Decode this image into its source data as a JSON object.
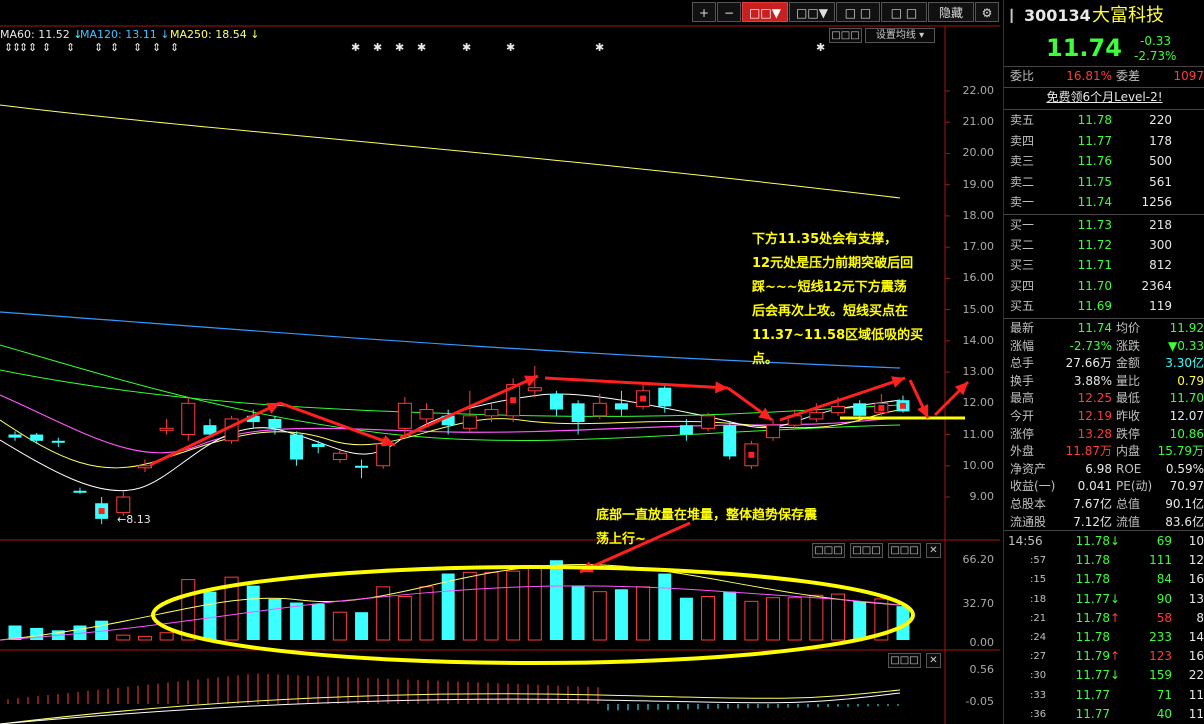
{
  "toolbar": {
    "plus": "+",
    "minus": "−",
    "btn3": "□□▼",
    "btn4": "□□▼",
    "btn5": "□ □",
    "btn6": "□ □",
    "hide": "隐藏",
    "settings_icon": "gear-icon"
  },
  "ma": {
    "ma60": "MA60: 11.52",
    "ma120": "MA120: 13.11",
    "ma250": "MA250: 18.54"
  },
  "chart_buttons": {
    "set_ma": "设置均线 ▾",
    "small": "□□□"
  },
  "price_axis": [
    "22.00",
    "21.00",
    "20.00",
    "19.00",
    "18.00",
    "17.00",
    "16.00",
    "15.00",
    "14.00",
    "13.00",
    "12.00",
    "11.00",
    "10.00",
    "9.00"
  ],
  "low_label": "8.13",
  "volume_axis": [
    "66.20",
    "32.70",
    "0.00"
  ],
  "macd_axis": [
    "0.56",
    "-0.05"
  ],
  "annotations": {
    "support": [
      "下方11.35处会有支撑，",
      "12元处是压力前期突破后回",
      "踩~~~短线12元下方震荡",
      "后会再次上攻。短线买点在",
      "11.37~11.58区域低吸的买",
      "点。"
    ],
    "volume_note": [
      "底部一直放量在堆量，整体趋势保存震",
      "荡上行~"
    ]
  },
  "chart_data": {
    "type": "candlestick",
    "ylim": [
      8,
      22.5
    ],
    "candles": [
      {
        "o": 11.0,
        "c": 10.9,
        "h": 11.1,
        "l": 10.8,
        "up": false
      },
      {
        "o": 11.0,
        "c": 10.8,
        "h": 11.05,
        "l": 10.7,
        "up": false
      },
      {
        "o": 10.8,
        "c": 10.75,
        "h": 10.9,
        "l": 10.6,
        "up": false
      },
      {
        "o": 9.2,
        "c": 9.2,
        "h": 9.3,
        "l": 9.1,
        "up": false
      },
      {
        "o": 8.8,
        "c": 8.3,
        "h": 9.0,
        "l": 8.13,
        "up": false
      },
      {
        "o": 8.5,
        "c": 9.0,
        "h": 9.2,
        "l": 8.4,
        "up": true
      },
      {
        "o": 10.0,
        "c": 10.0,
        "h": 10.2,
        "l": 9.8,
        "up": true
      },
      {
        "o": 11.2,
        "c": 11.2,
        "h": 11.5,
        "l": 11.0,
        "up": true
      },
      {
        "o": 11.0,
        "c": 12.0,
        "h": 12.2,
        "l": 10.8,
        "up": true
      },
      {
        "o": 11.3,
        "c": 11.0,
        "h": 11.5,
        "l": 10.9,
        "up": false
      },
      {
        "o": 10.8,
        "c": 11.5,
        "h": 11.6,
        "l": 10.7,
        "up": true
      },
      {
        "o": 11.6,
        "c": 11.4,
        "h": 11.8,
        "l": 11.2,
        "up": false
      },
      {
        "o": 11.5,
        "c": 11.2,
        "h": 11.6,
        "l": 11.0,
        "up": false
      },
      {
        "o": 11.0,
        "c": 10.2,
        "h": 11.1,
        "l": 10.0,
        "up": false
      },
      {
        "o": 10.7,
        "c": 10.6,
        "h": 10.8,
        "l": 10.4,
        "up": false
      },
      {
        "o": 10.4,
        "c": 10.2,
        "h": 10.5,
        "l": 10.1,
        "up": true
      },
      {
        "o": 10.0,
        "c": 10.0,
        "h": 10.2,
        "l": 9.6,
        "up": false
      },
      {
        "o": 10.0,
        "c": 10.7,
        "h": 10.9,
        "l": 9.9,
        "up": true
      },
      {
        "o": 11.2,
        "c": 12.0,
        "h": 12.2,
        "l": 11.0,
        "up": true
      },
      {
        "o": 11.5,
        "c": 11.8,
        "h": 12.0,
        "l": 11.3,
        "up": true
      },
      {
        "o": 11.6,
        "c": 11.3,
        "h": 11.8,
        "l": 11.0,
        "up": false
      },
      {
        "o": 11.2,
        "c": 11.6,
        "h": 12.4,
        "l": 11.1,
        "up": true
      },
      {
        "o": 11.8,
        "c": 11.6,
        "h": 12.0,
        "l": 11.4,
        "up": true
      },
      {
        "o": 11.6,
        "c": 12.6,
        "h": 12.8,
        "l": 11.4,
        "up": true
      },
      {
        "o": 12.4,
        "c": 12.5,
        "h": 13.2,
        "l": 12.2,
        "up": true
      },
      {
        "o": 12.3,
        "c": 11.8,
        "h": 12.4,
        "l": 11.6,
        "up": false
      },
      {
        "o": 12.0,
        "c": 11.4,
        "h": 12.1,
        "l": 11.0,
        "up": false
      },
      {
        "o": 11.6,
        "c": 12.0,
        "h": 12.3,
        "l": 11.5,
        "up": true
      },
      {
        "o": 12.0,
        "c": 11.8,
        "h": 12.4,
        "l": 11.6,
        "up": false
      },
      {
        "o": 11.9,
        "c": 12.4,
        "h": 12.6,
        "l": 11.8,
        "up": true
      },
      {
        "o": 12.5,
        "c": 11.9,
        "h": 12.6,
        "l": 11.7,
        "up": false
      },
      {
        "o": 11.3,
        "c": 11.0,
        "h": 11.5,
        "l": 10.8,
        "up": false
      },
      {
        "o": 11.2,
        "c": 11.6,
        "h": 11.7,
        "l": 11.1,
        "up": true
      },
      {
        "o": 11.3,
        "c": 10.3,
        "h": 11.4,
        "l": 10.2,
        "up": false
      },
      {
        "o": 10.0,
        "c": 10.7,
        "h": 10.8,
        "l": 9.9,
        "up": true
      },
      {
        "o": 10.9,
        "c": 11.3,
        "h": 11.5,
        "l": 10.8,
        "up": true
      },
      {
        "o": 11.3,
        "c": 11.6,
        "h": 11.8,
        "l": 11.2,
        "up": true
      },
      {
        "o": 11.5,
        "c": 11.7,
        "h": 12.0,
        "l": 11.4,
        "up": true
      },
      {
        "o": 11.7,
        "c": 11.9,
        "h": 12.2,
        "l": 11.6,
        "up": true
      },
      {
        "o": 12.0,
        "c": 11.6,
        "h": 12.1,
        "l": 11.5,
        "up": false
      },
      {
        "o": 11.7,
        "c": 12.0,
        "h": 12.3,
        "l": 11.6,
        "up": true
      },
      {
        "o": 12.1,
        "c": 11.74,
        "h": 12.25,
        "l": 11.7,
        "up": false
      }
    ],
    "volumes": [
      12,
      10,
      8,
      12,
      16,
      4,
      3,
      6,
      50,
      40,
      52,
      45,
      34,
      31,
      30,
      23,
      23,
      44,
      36,
      44,
      55,
      56,
      56,
      57,
      60,
      66,
      45,
      40,
      42,
      44,
      55,
      35,
      36,
      40,
      32,
      35,
      35,
      37,
      38,
      32,
      34,
      28
    ]
  },
  "quote": {
    "code": "300134",
    "name": "大富科技",
    "price": "11.74",
    "change": "-0.33",
    "change_pct": "-2.73%",
    "weibi_label": "委比",
    "weibi": "16.81%",
    "weicha_label": "委差",
    "weicha": "1097",
    "promo": "免费领6个月Level-2!",
    "asks": [
      {
        "label": "卖五",
        "price": "11.78",
        "vol": "220"
      },
      {
        "label": "卖四",
        "price": "11.77",
        "vol": "178"
      },
      {
        "label": "卖三",
        "price": "11.76",
        "vol": "500"
      },
      {
        "label": "卖二",
        "price": "11.75",
        "vol": "561"
      },
      {
        "label": "卖一",
        "price": "11.74",
        "vol": "1256"
      }
    ],
    "bids": [
      {
        "label": "买一",
        "price": "11.73",
        "vol": "218"
      },
      {
        "label": "买二",
        "price": "11.72",
        "vol": "300"
      },
      {
        "label": "买三",
        "price": "11.71",
        "vol": "812"
      },
      {
        "label": "买四",
        "price": "11.70",
        "vol": "2364"
      },
      {
        "label": "买五",
        "price": "11.69",
        "vol": "119"
      }
    ],
    "stats": [
      {
        "l1": "最新",
        "v1": "11.74",
        "c1": "green",
        "l2": "均价",
        "v2": "11.92",
        "c2": "green"
      },
      {
        "l1": "涨幅",
        "v1": "-2.73%",
        "c1": "green",
        "l2": "涨跌",
        "v2": "▼0.33",
        "c2": "green"
      },
      {
        "l1": "总手",
        "v1": "27.66万",
        "c1": "white",
        "l2": "金额",
        "v2": "3.30亿",
        "c2": "cyan"
      },
      {
        "l1": "换手",
        "v1": "3.88%",
        "c1": "white",
        "l2": "量比",
        "v2": "0.79",
        "c2": "yellow"
      },
      {
        "l1": "最高",
        "v1": "12.25",
        "c1": "red",
        "l2": "最低",
        "v2": "11.70",
        "c2": "green"
      },
      {
        "l1": "今开",
        "v1": "12.19",
        "c1": "red",
        "l2": "昨收",
        "v2": "12.07",
        "c2": "white"
      },
      {
        "l1": "涨停",
        "v1": "13.28",
        "c1": "red",
        "l2": "跌停",
        "v2": "10.86",
        "c2": "green"
      },
      {
        "l1": "外盘",
        "v1": "11.87万",
        "c1": "red",
        "l2": "内盘",
        "v2": "15.79万",
        "c2": "green"
      },
      {
        "l1": "净资产",
        "v1": "6.98",
        "c1": "white",
        "l2": "ROE",
        "v2": "0.59%",
        "c2": "white"
      },
      {
        "l1": "收益(一)",
        "v1": "0.041",
        "c1": "white",
        "l2": "PE(动)",
        "v2": "70.97",
        "c2": "white"
      },
      {
        "l1": "总股本",
        "v1": "7.67亿",
        "c1": "white",
        "l2": "总值",
        "v2": "90.1亿",
        "c2": "white"
      },
      {
        "l1": "流通股",
        "v1": "7.12亿",
        "c1": "white",
        "l2": "流值",
        "v2": "83.6亿",
        "c2": "white"
      }
    ],
    "ticks": [
      {
        "t": "14:56",
        "p": "11.78",
        "a": "↓",
        "ac": "green",
        "v": "69",
        "n": "10"
      },
      {
        "t": ":57",
        "p": "11.78",
        "a": "",
        "ac": "",
        "v": "111",
        "n": "12"
      },
      {
        "t": ":15",
        "p": "11.78",
        "a": "",
        "ac": "",
        "v": "84",
        "n": "16"
      },
      {
        "t": ":18",
        "p": "11.77",
        "a": "↓",
        "ac": "green",
        "v": "90",
        "n": "13"
      },
      {
        "t": ":21",
        "p": "11.78",
        "a": "↑",
        "ac": "red",
        "v": "58",
        "n": "8"
      },
      {
        "t": ":24",
        "p": "11.78",
        "a": "",
        "ac": "",
        "v": "233",
        "n": "14"
      },
      {
        "t": ":27",
        "p": "11.79",
        "a": "↑",
        "ac": "red",
        "v": "123",
        "n": "16"
      },
      {
        "t": ":30",
        "p": "11.77",
        "a": "↓",
        "ac": "green",
        "v": "159",
        "n": "22"
      },
      {
        "t": ":33",
        "p": "11.77",
        "a": "",
        "ac": "",
        "v": "71",
        "n": "11"
      },
      {
        "t": ":36",
        "p": "11.77",
        "a": "",
        "ac": "",
        "v": "40",
        "n": "11"
      }
    ]
  },
  "colors": {
    "up": "#ff3c3c",
    "down": "#3cffff",
    "ma_yellow": "#ffff66",
    "ma_white": "#ffffff",
    "ma_magenta": "#ff55ff",
    "ma_green": "#33ff33",
    "ma_blue": "#3399ff",
    "arrow": "#ff2020",
    "ellipse": "#ffff00"
  }
}
